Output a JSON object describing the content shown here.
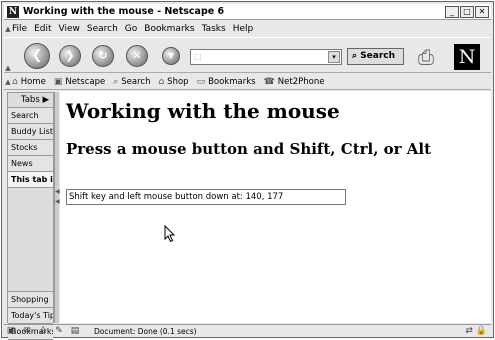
{
  "window": {
    "title": "Working with the mouse - Netscape 6",
    "logo_letter": "N",
    "controls": [
      "_",
      "□",
      "✕"
    ]
  },
  "menubar": {
    "items": [
      "File",
      "Edit",
      "View",
      "Search",
      "Go",
      "Bookmarks",
      "Tasks",
      "Help"
    ]
  },
  "toolbar": {
    "search_label": "Search",
    "logo_letter": "N"
  },
  "personal_toolbar": {
    "items": [
      "Home",
      "Netscape",
      "Search",
      "Shop",
      "Bookmarks",
      "Net2Phone"
    ]
  },
  "sidebar": {
    "tabs_label": "Tabs ▶",
    "items": [
      "Search",
      "Buddy List",
      "Stocks",
      "News",
      "This tab is"
    ],
    "bottom_items": [
      "Shopping",
      "Today's Tip",
      "Bookmarks"
    ]
  },
  "page": {
    "heading": "Working with the mouse",
    "subheading": "Press a mouse button and Shift, Ctrl, or Alt",
    "textbox_value": "Shift key and left mouse button down at: 140, 177"
  },
  "statusbar": {
    "text": "Document: Done (0.1 secs)"
  }
}
